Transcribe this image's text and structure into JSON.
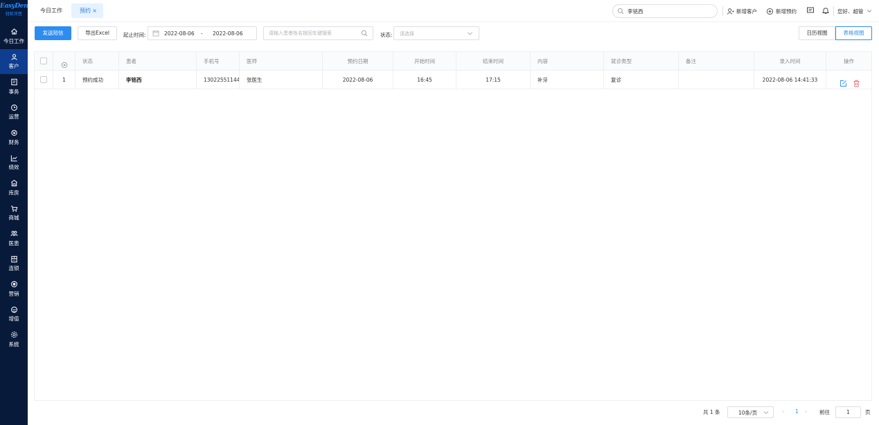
{
  "logo": {
    "title": "EasyDent",
    "subtitle": "轻松牙医"
  },
  "sidebar": {
    "items": [
      {
        "label": "今日工作",
        "icon": "home-icon"
      },
      {
        "label": "客户",
        "icon": "user-icon",
        "active": true
      },
      {
        "label": "事务",
        "icon": "task-icon"
      },
      {
        "label": "运营",
        "icon": "clock-icon"
      },
      {
        "label": "财务",
        "icon": "money-icon"
      },
      {
        "label": "绩效",
        "icon": "chart-icon"
      },
      {
        "label": "库房",
        "icon": "warehouse-icon"
      },
      {
        "label": "商城",
        "icon": "cart-icon"
      },
      {
        "label": "医患",
        "icon": "people-icon"
      },
      {
        "label": "连锁",
        "icon": "chain-icon"
      },
      {
        "label": "营销",
        "icon": "marketing-icon"
      },
      {
        "label": "增值",
        "icon": "value-icon"
      },
      {
        "label": "系统",
        "icon": "settings-icon"
      }
    ]
  },
  "tabs": [
    {
      "label": "今日工作"
    },
    {
      "label": "预约",
      "close": "×"
    }
  ],
  "topbar": {
    "search_value": "李铭西",
    "new_customer": "新增客户",
    "new_appointment": "新增预约",
    "greeting": "您好、超管"
  },
  "toolbar": {
    "send_sms": "发送短信",
    "export_excel": "导出Excel",
    "date_label": "起止时间:",
    "date_start": "2022-08-06",
    "date_sep": "-",
    "date_end": "2022-08-06",
    "keyword_placeholder": "请输入患者姓名按回车键搜索",
    "status_label": "状态:",
    "status_placeholder": "请选择",
    "calendar_view": "日历视图",
    "table_view": "表格视图"
  },
  "table": {
    "headers": [
      "状态",
      "患者",
      "手机号",
      "医师",
      "预约日期",
      "开始时间",
      "结束时间",
      "内容",
      "就诊类型",
      "备注",
      "录入时间",
      "操作"
    ],
    "rows": [
      {
        "index": "1",
        "status": "预约成功",
        "patient": "李铭西",
        "phone": "13022551144",
        "doctor": "张医生",
        "date": "2022-08-06",
        "start": "16:45",
        "end": "17:15",
        "content": "补牙",
        "visit_type": "复诊",
        "note": "",
        "created": "2022-08-06 14:41:33"
      }
    ]
  },
  "pagination": {
    "total": "共 1 条",
    "page_size": "10条/页",
    "prev": "‹",
    "current": "1",
    "next": "›",
    "goto": "前往",
    "goto_value": "1",
    "page_unit": "页"
  },
  "colors": {
    "sidebar_bg": "#081a3a",
    "primary": "#2d8cf0",
    "danger": "#f56c6c"
  }
}
